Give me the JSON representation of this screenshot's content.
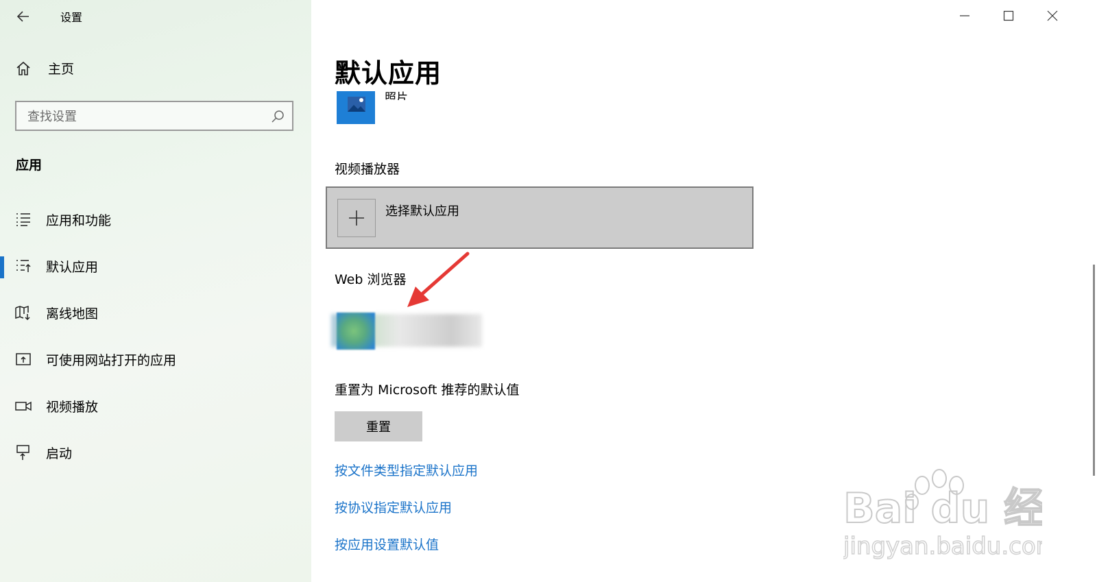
{
  "window": {
    "title": "设置"
  },
  "sidebar": {
    "home_label": "主页",
    "search_placeholder": "查找设置",
    "section_title": "应用",
    "items": [
      {
        "label": "应用和功能",
        "icon": "list-icon"
      },
      {
        "label": "默认应用",
        "icon": "default-apps-icon",
        "active": true
      },
      {
        "label": "离线地图",
        "icon": "map-download-icon"
      },
      {
        "label": "可使用网站打开的应用",
        "icon": "open-with-icon"
      },
      {
        "label": "视频播放",
        "icon": "video-camera-icon"
      },
      {
        "label": "启动",
        "icon": "startup-icon"
      }
    ]
  },
  "main": {
    "title": "默认应用",
    "photo_app_name": "照片",
    "video_player": {
      "label": "视频播放器",
      "choose_label": "选择默认应用"
    },
    "web_browser": {
      "label": "Web 浏览器"
    },
    "reset": {
      "label": "重置为 Microsoft 推荐的默认值",
      "button": "重置"
    },
    "links": [
      "按文件类型指定默认应用",
      "按协议指定默认应用",
      "按应用设置默认值"
    ]
  },
  "watermark": {
    "brand": "Bai du 经验",
    "url": "jingyan.baidu.com"
  },
  "colors": {
    "accent": "#1a73c9",
    "sidebar_bg": "#eaf3ea",
    "arrow": "#e53935",
    "tile": "#1e7fd6"
  }
}
